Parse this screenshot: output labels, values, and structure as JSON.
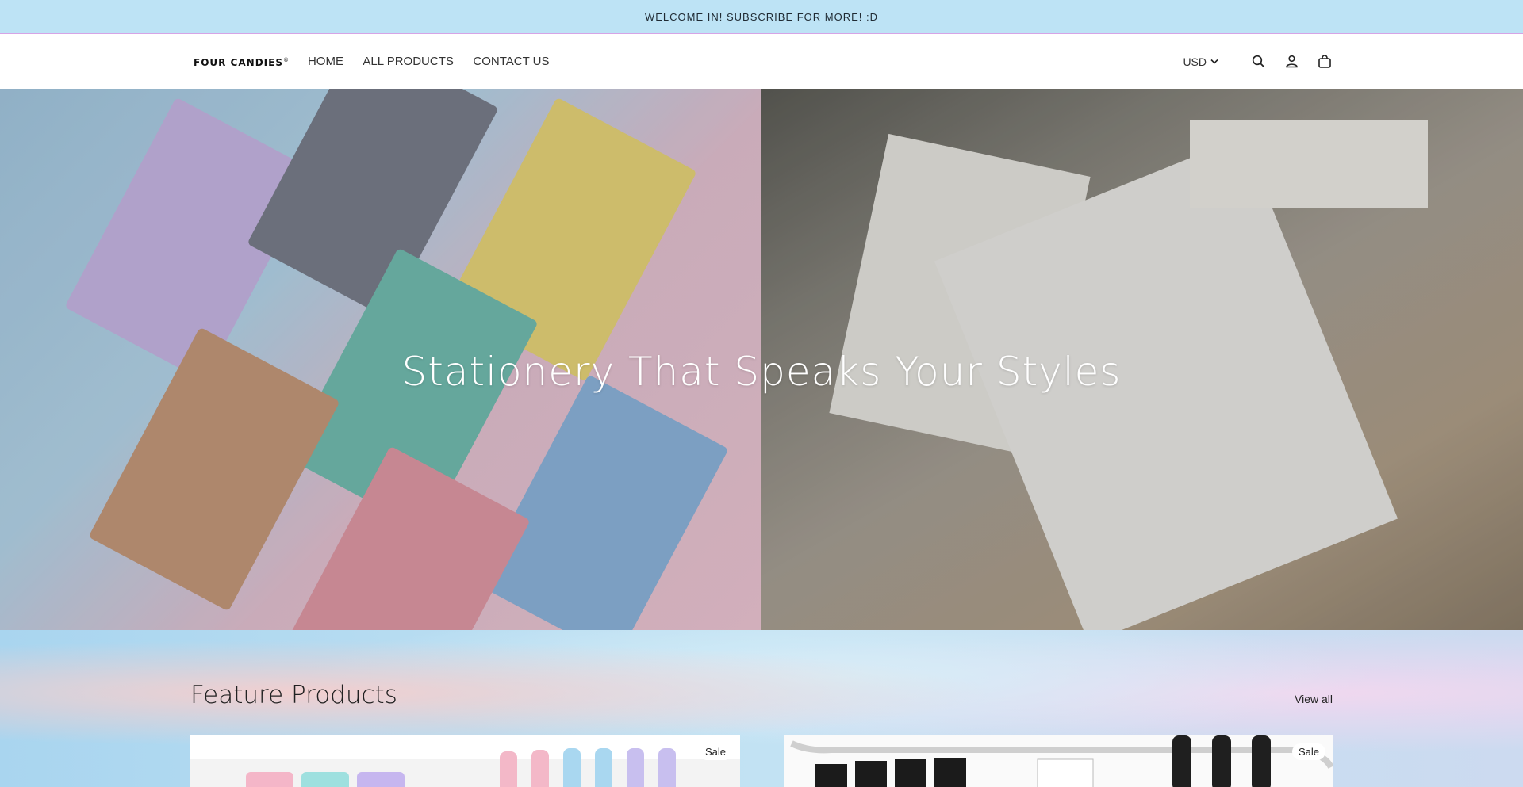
{
  "announcement": "WELCOME IN! SUBSCRIBE FOR MORE! :D",
  "header": {
    "logo": "FOUR CANDIES",
    "logo_mark": "®",
    "nav": [
      "HOME",
      "ALL PRODUCTS",
      "CONTACT US"
    ],
    "currency": "USD",
    "icons": [
      "search-icon",
      "account-icon",
      "cart-icon"
    ]
  },
  "hero": {
    "title": "Stationery That Speaks Your Styles"
  },
  "feature": {
    "title": "Feature Products",
    "view_all": "View all",
    "cards": [
      {
        "badge": "Sale"
      },
      {
        "badge": "Sale"
      }
    ]
  },
  "colors": {
    "announcement_bg": "#bde3f5",
    "announcement_border": "#d6a4e6"
  }
}
